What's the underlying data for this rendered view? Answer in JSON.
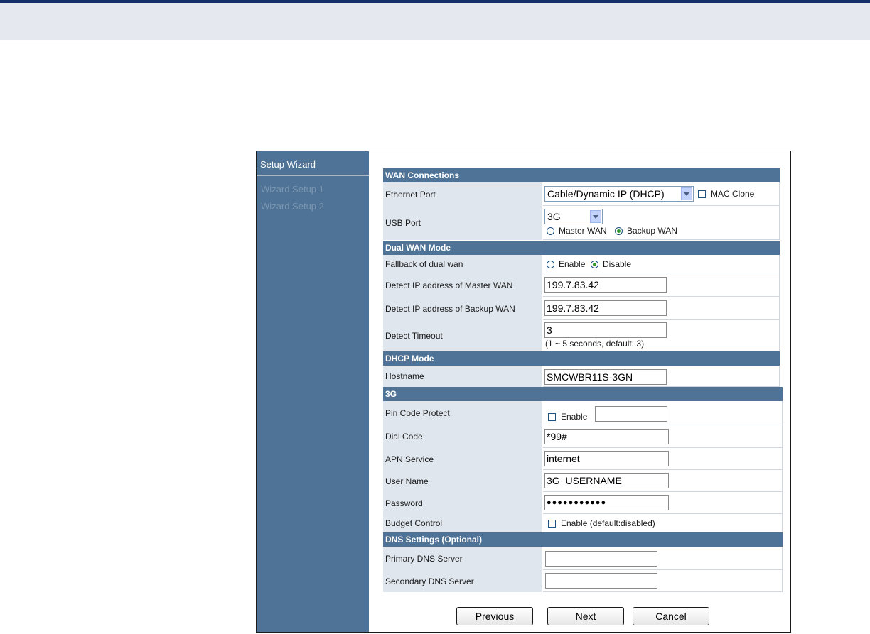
{
  "sidebar": {
    "title": "Setup Wizard",
    "items": [
      {
        "label": "Wizard Setup 1"
      },
      {
        "label": "Wizard Setup 2"
      }
    ]
  },
  "sections": {
    "wan": "WAN Connections",
    "dual": "Dual WAN Mode",
    "dhcp": "DHCP Mode",
    "g3": "3G",
    "dns": "DNS Settings (Optional)"
  },
  "ethernet": {
    "label": "Ethernet Port",
    "selected": "Cable/Dynamic IP (DHCP)",
    "mac_clone_label": "MAC Clone"
  },
  "usb": {
    "label": "USB Port",
    "selected": "3G",
    "master_label": "Master WAN",
    "backup_label": "Backup WAN",
    "mode": "Backup WAN"
  },
  "fallback": {
    "label": "Fallback of dual wan",
    "enable_label": "Enable",
    "disable_label": "Disable",
    "value": "Disable"
  },
  "detect_master": {
    "label": "Detect IP address of Master WAN",
    "value": "199.7.83.42"
  },
  "detect_backup": {
    "label": "Detect IP address of Backup WAN",
    "value": "199.7.83.42"
  },
  "detect_timeout": {
    "label": "Detect Timeout",
    "value": "3",
    "hint": "(1 ~ 5 seconds, default: 3)"
  },
  "hostname": {
    "label": "Hostname",
    "value": "SMCWBR11S-3GN"
  },
  "pin": {
    "label": "Pin Code Protect",
    "enable_label": "Enable",
    "value": ""
  },
  "dial_code": {
    "label": "Dial Code",
    "value": "*99#"
  },
  "apn": {
    "label": "APN Service",
    "value": "internet"
  },
  "username": {
    "label": "User Name",
    "value": "3G_USERNAME"
  },
  "password": {
    "label": "Password",
    "value": "●●●●●●●●●●●"
  },
  "budget": {
    "label": "Budget Control",
    "enable_label": "Enable (default:disabled)"
  },
  "dns1": {
    "label": "Primary DNS Server",
    "value": ""
  },
  "dns2": {
    "label": "Secondary DNS Server",
    "value": ""
  },
  "buttons": {
    "previous": "Previous",
    "next": "Next",
    "cancel": "Cancel"
  },
  "colors": {
    "header_navy": "#14316b",
    "panel_blue": "#4f7396",
    "label_bg": "#dfe6ee"
  }
}
